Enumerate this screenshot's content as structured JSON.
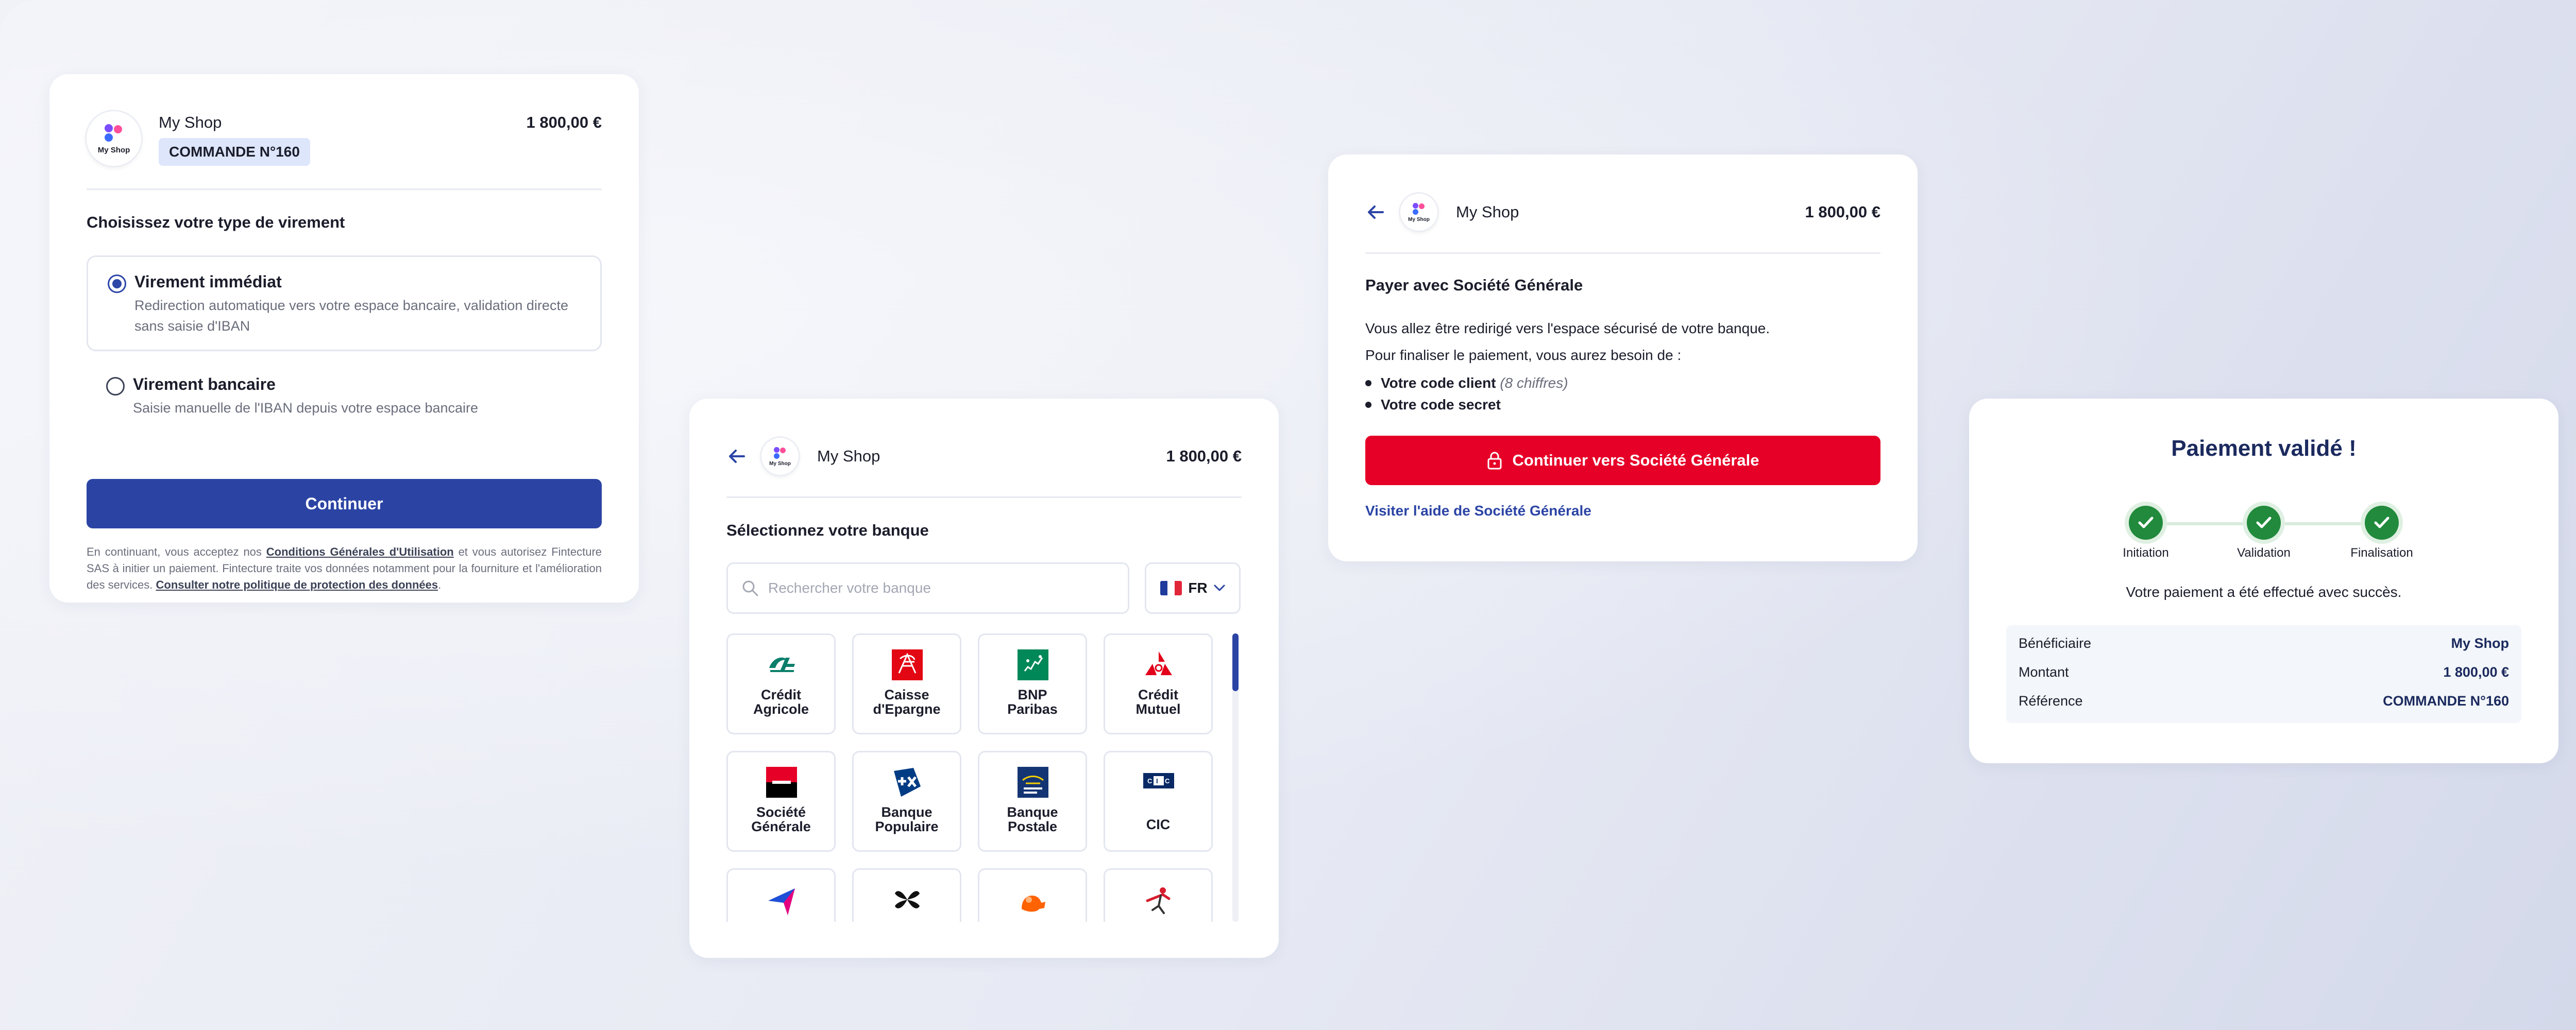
{
  "colors": {
    "primary": "#2b44a4",
    "societe_generale_red": "#e60028",
    "success_green": "#218a3c"
  },
  "shop": {
    "name": "My Shop",
    "logo_text": "My Shop",
    "amount": "1 800,00 €",
    "order": "COMMANDE N°160"
  },
  "card1": {
    "heading": "Choisissez votre type de virement",
    "options": [
      {
        "title": "Virement immédiat",
        "description": "Redirection automatique vers votre espace bancaire, validation directe sans saisie d'IBAN",
        "selected": true
      },
      {
        "title": "Virement bancaire",
        "description": "Saisie manuelle de l'IBAN depuis votre espace bancaire",
        "selected": false
      }
    ],
    "continue_label": "Continuer",
    "legal": {
      "part1": "En continuant, vous acceptez nos ",
      "link1": "Conditions Générales d'Utilisation",
      "part2": " et vous autorisez Fintecture SAS à initier un paiement. Fintecture traite vos données notamment pour la fourniture et l'amélioration des services. ",
      "link2": "Consulter notre politique de protection des données",
      "part3": "."
    }
  },
  "card2": {
    "heading": "Sélectionnez votre banque",
    "search_placeholder": "Rechercher votre banque",
    "country": "FR",
    "banks": [
      {
        "name": "Crédit\nAgricole",
        "icon": "credit-agricole-logo"
      },
      {
        "name": "Caisse\nd'Epargne",
        "icon": "caisse-epargne-logo"
      },
      {
        "name": "BNP\nParibas",
        "icon": "bnp-paribas-logo"
      },
      {
        "name": "Crédit\nMutuel",
        "icon": "credit-mutuel-logo"
      },
      {
        "name": "Société\nGénérale",
        "icon": "societe-generale-logo"
      },
      {
        "name": "Banque\nPopulaire",
        "icon": "banque-populaire-logo"
      },
      {
        "name": "Banque\nPostale",
        "icon": "banque-postale-logo"
      },
      {
        "name": "CIC",
        "icon": "cic-logo"
      },
      {
        "name": "",
        "icon": "arrow-bank-logo"
      },
      {
        "name": "",
        "icon": "x-bank-logo"
      },
      {
        "name": "",
        "icon": "lion-bank-logo"
      },
      {
        "name": "",
        "icon": "figure-bank-logo"
      }
    ]
  },
  "card3": {
    "heading": "Payer avec Société Générale",
    "line1": "Vous allez être redirigé vers l'espace sécurisé de votre banque.",
    "line2": "Pour finaliser le paiement, vous aurez besoin de :",
    "bullets": [
      {
        "strong": "Votre code client",
        "hint": "(8 chiffres)"
      },
      {
        "strong": "Votre code secret",
        "hint": ""
      }
    ],
    "button_label": "Continuer vers Société Générale",
    "help_link": "Visiter l'aide de Société Générale"
  },
  "card4": {
    "title": "Paiement validé !",
    "steps": [
      "Initiation",
      "Validation",
      "Finalisation"
    ],
    "message": "Votre paiement a été effectué avec succès.",
    "summary": [
      {
        "label": "Bénéficiaire",
        "value": "My Shop"
      },
      {
        "label": "Montant",
        "value": "1 800,00 €"
      },
      {
        "label": "Référence",
        "value": "COMMANDE N°160"
      }
    ]
  }
}
